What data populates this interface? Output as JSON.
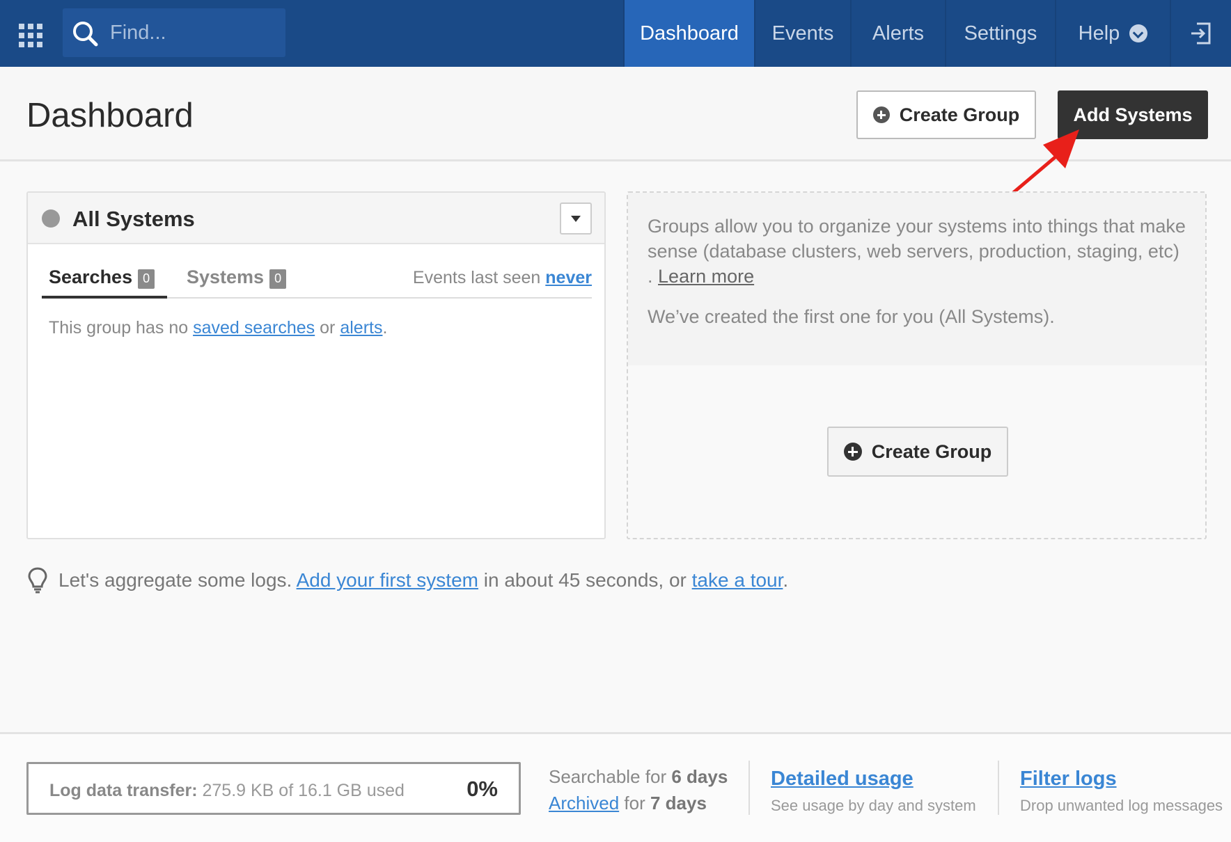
{
  "nav": {
    "search_placeholder": "Find...",
    "items": [
      {
        "label": "Dashboard",
        "active": true
      },
      {
        "label": "Events"
      },
      {
        "label": "Alerts"
      },
      {
        "label": "Settings"
      },
      {
        "label": "Help"
      }
    ]
  },
  "header": {
    "title": "Dashboard",
    "create_group_label": "Create Group",
    "add_systems_label": "Add Systems"
  },
  "group_card": {
    "title": "All Systems",
    "tabs": [
      {
        "label": "Searches",
        "count": "0"
      },
      {
        "label": "Systems",
        "count": "0"
      }
    ],
    "events_seen_prefix": "Events last seen",
    "events_seen_value": "never",
    "empty_prefix": "This group has no",
    "empty_link1": "saved searches",
    "empty_mid": "or",
    "empty_link2": "alerts",
    "empty_suffix": "."
  },
  "groups_info": {
    "text1": "Groups allow you to organize your systems into things that make sense (database clusters, web servers, production, staging, etc) .",
    "learn_more": "Learn more",
    "text2": "We’ve created the first one for you (All Systems).",
    "create_group_label": "Create Group"
  },
  "tip": {
    "prefix": "Let's aggregate some logs.",
    "link1": "Add your first system",
    "mid": "in about 45 seconds, or",
    "link2": "take a tour",
    "suffix": "."
  },
  "footer": {
    "usage_label": "Log data transfer:",
    "usage_value": "275.9 KB of 16.1 GB used",
    "usage_percent": "0%",
    "searchable_prefix": "Searchable for",
    "searchable_days": "6 days",
    "archived_link": "Archived",
    "archived_mid": "for",
    "archived_days": "7 days",
    "detailed_usage_link": "Detailed usage",
    "detailed_usage_sub": "See usage by day and system",
    "filter_logs_link": "Filter logs",
    "filter_logs_sub": "Drop unwanted log messages"
  },
  "colors": {
    "nav_bg": "#1a4a87",
    "nav_active": "#2766b8",
    "link": "#3a86d4",
    "annotation_arrow": "#e8201a"
  }
}
